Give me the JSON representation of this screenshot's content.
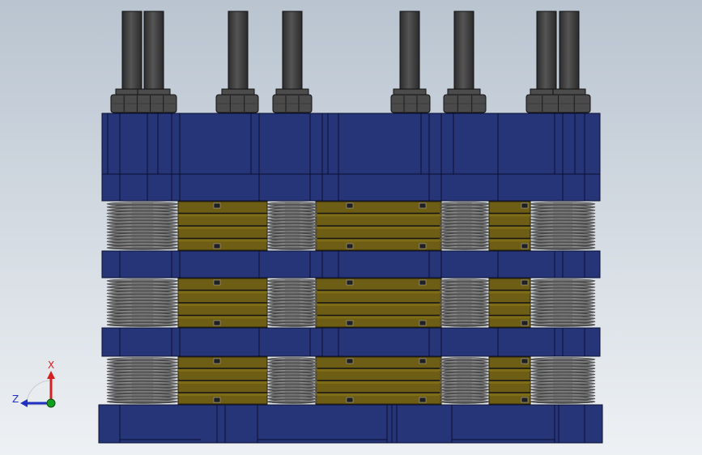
{
  "viewport": {
    "background_top": "#b9c4d0",
    "background_bottom": "#eef1f4"
  },
  "colors": {
    "plate": "#263478",
    "plate_edge": "#0a1030",
    "spring": "#8c8c8c",
    "spring_dark": "#3c3c3c",
    "pad": "#6e5d14",
    "pad_band": "#8a7618",
    "bolt": "#3c3c3c",
    "nut": "#4a4a4a",
    "axis_x": "#d42020",
    "axis_z": "#2030c0",
    "origin": "#10a020"
  },
  "triad": {
    "x_label": "X",
    "z_label": "Z"
  }
}
